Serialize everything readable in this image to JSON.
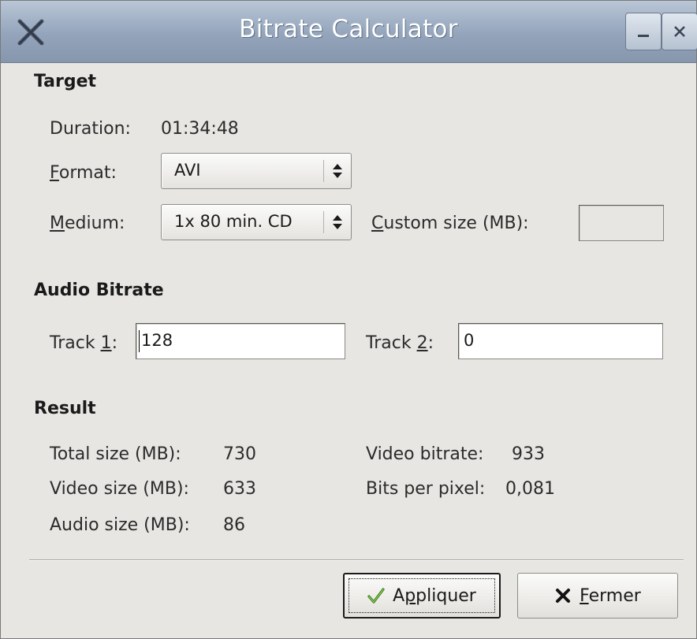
{
  "window": {
    "title": "Bitrate Calculator"
  },
  "titlebar_icons": {
    "app": "x-tool-icon",
    "minimize": "minimize-icon",
    "close": "close-icon"
  },
  "target": {
    "section_title": "Target",
    "duration_label": "Duration:",
    "duration_value": "01:34:48",
    "format_label_first": "F",
    "format_label_rest": "ormat:",
    "format_value": "AVI",
    "medium_label_first": "M",
    "medium_label_rest": "edium:",
    "medium_value": "1x 80 min. CD",
    "custom_size_label_first": "C",
    "custom_size_label_rest": "ustom size (MB):",
    "custom_size_value": ""
  },
  "audio": {
    "section_title": "Audio Bitrate",
    "track1_label_pre": "Track ",
    "track1_label_key": "1",
    "track1_label_post": ":",
    "track1_value": "128",
    "track2_label_pre": "Track ",
    "track2_label_key": "2",
    "track2_label_post": ":",
    "track2_value": "0"
  },
  "result": {
    "section_title": "Result",
    "total_size_label": "Total size (MB):",
    "total_size_value": "730",
    "video_size_label": "Video size (MB):",
    "video_size_value": "633",
    "audio_size_label": "Audio size (MB):",
    "audio_size_value": "86",
    "video_bitrate_label": "Video bitrate:",
    "video_bitrate_value": "933",
    "bpp_label": "Bits per pixel:",
    "bpp_value": "0,081"
  },
  "buttons": {
    "apply_first": "A",
    "apply_key": "p",
    "apply_rest": "pliquer",
    "close_key": "F",
    "close_rest": "ermer"
  },
  "colors": {
    "titlebar": "#93a4bb",
    "window_bg": "#e8e6e3"
  }
}
